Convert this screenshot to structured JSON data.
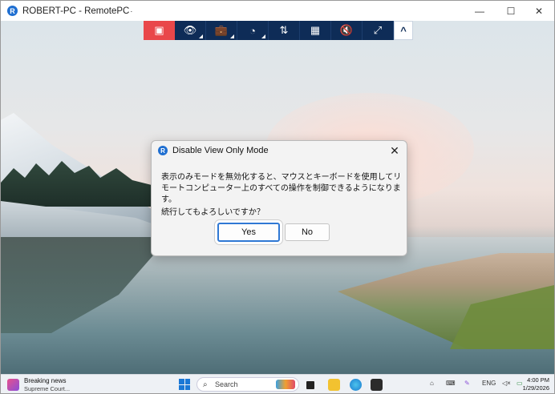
{
  "window": {
    "title": "ROBERT-PC - RemotePC",
    "title_suffix": "·",
    "app_icon_letter": "R",
    "controls": {
      "minimize": "—",
      "maximize": "☐",
      "close": "✕"
    }
  },
  "toolbar": {
    "items": [
      {
        "name": "exit-remote",
        "icon": "screen-x-icon",
        "glyph": "▣",
        "color": "#e9474a"
      },
      {
        "name": "view-only",
        "icon": "eye-icon",
        "glyph": "👁"
      },
      {
        "name": "tools",
        "icon": "briefcase-icon",
        "glyph": "💼"
      },
      {
        "name": "performance",
        "icon": "gauge-icon",
        "glyph": "◔"
      },
      {
        "name": "transfer",
        "icon": "swap-arrows-icon",
        "glyph": "⇅"
      },
      {
        "name": "apps",
        "icon": "grid-icon",
        "glyph": "▦"
      },
      {
        "name": "sound",
        "icon": "speaker-mute-icon",
        "glyph": "🔇"
      },
      {
        "name": "fullscreen",
        "icon": "expand-icon",
        "glyph": "⤢"
      },
      {
        "name": "collapse",
        "icon": "chevron-up-icon",
        "glyph": "^"
      }
    ],
    "bg_color": "#0e2c57"
  },
  "dialog": {
    "title": "Disable View Only Mode",
    "close_glyph": "✕",
    "message": "表示のみモードを無効化すると、マウスとキーボードを使用してリモートコンピューター上のすべての操作を制御できるようになります。",
    "question": "続行してもよろしいですか？",
    "yes_label": "Yes",
    "no_label": "No"
  },
  "taskbar": {
    "news_title": "Breaking news",
    "news_subtitle": "Supreme Court...",
    "search_placeholder": "Search",
    "search_glyph": "⌕",
    "language": "ENG",
    "time": "4:00 PM",
    "date": "1/29/2026"
  }
}
